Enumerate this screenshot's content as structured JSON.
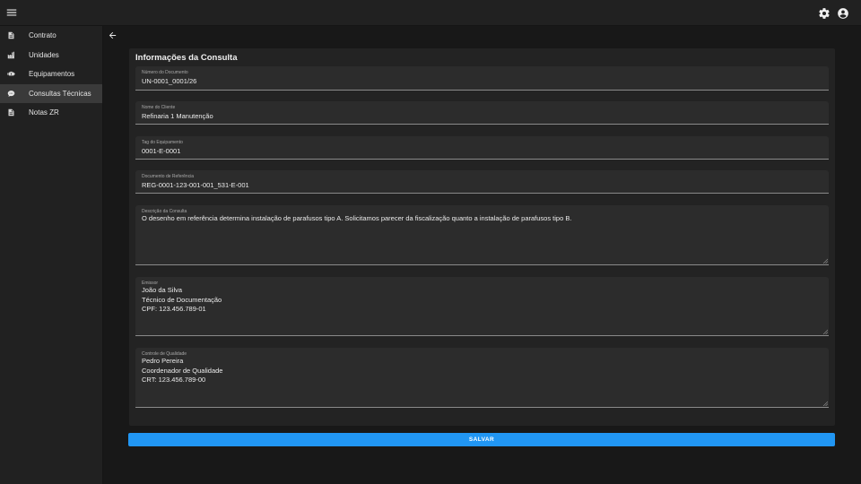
{
  "colors": {
    "background": "#181818",
    "appbar": "#212121",
    "card": "#232323",
    "field": "#2c2c2c",
    "accent": "#2196f3"
  },
  "topbar": {
    "menu_icon": "hamburger-menu-icon",
    "settings_icon": "gear-icon",
    "account_icon": "account-circle-icon"
  },
  "sidebar": {
    "items": [
      {
        "label": "Contrato",
        "icon": "document-icon",
        "active": false
      },
      {
        "label": "Unidades",
        "icon": "factory-icon",
        "active": false
      },
      {
        "label": "Equipamentos",
        "icon": "pump-icon",
        "active": false
      },
      {
        "label": "Consultas Técnicas",
        "icon": "comment-icon",
        "active": true
      },
      {
        "label": "Notas ZR",
        "icon": "document-icon",
        "active": false
      }
    ]
  },
  "back_icon": "arrow-left-icon",
  "form": {
    "title": "Informações da Consulta",
    "fields": {
      "numero_documento": {
        "label": "Número do Documento",
        "value": "UN-0001_0001/26"
      },
      "nome_cliente": {
        "label": "Nome do Cliente",
        "value": "Refinaria 1 Manutenção"
      },
      "tag_equipamento": {
        "label": "Tag do Equipamento",
        "value": "0001-E-0001"
      },
      "documento_referencia": {
        "label": "Documento de Referência",
        "value": "REG-0001-123-001-001_531-E-001"
      },
      "descricao_consulta": {
        "label": "Descrição da Consulta",
        "value": "O desenho em referência determina instalação de parafusos tipo A. Solicitamos parecer da fiscalização quanto a instalação de parafusos tipo B."
      },
      "emissor": {
        "label": "Emissor",
        "value": "João da Silva\nTécnico de Documentação\nCPF: 123.456.789-01"
      },
      "controle_qualidade": {
        "label": "Controle de Qualidade",
        "value": "Pedro Pereira\nCoordenador de Qualidade\nCRT: 123.456.789-00"
      }
    },
    "save_label": "SALVAR"
  }
}
